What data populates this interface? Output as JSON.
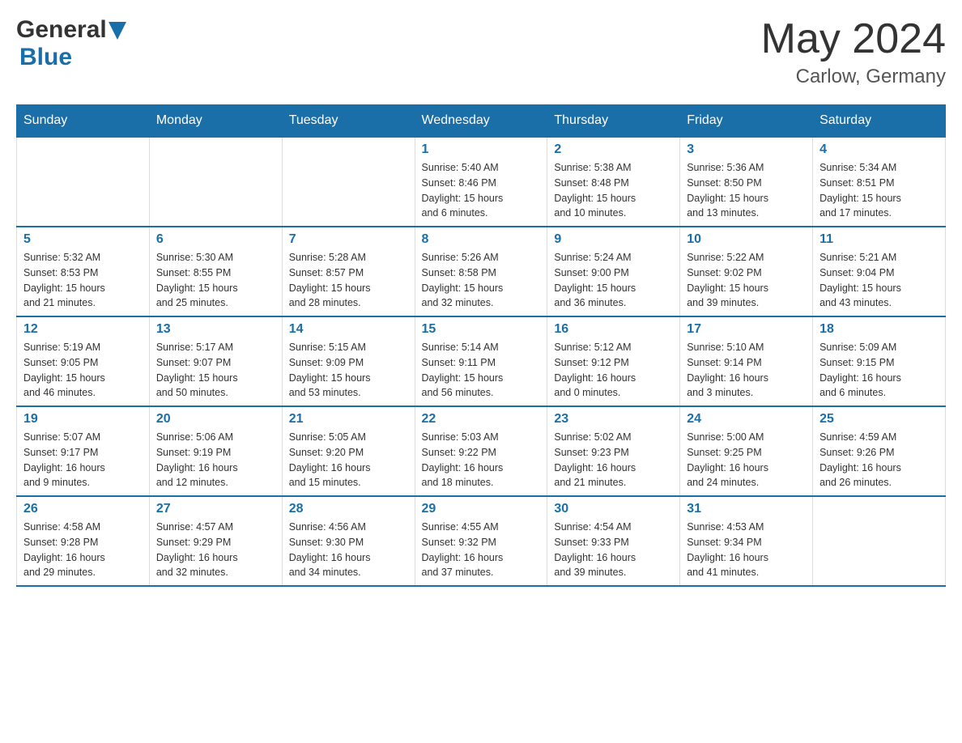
{
  "header": {
    "logo_general": "General",
    "logo_blue": "Blue",
    "month_year": "May 2024",
    "location": "Carlow, Germany"
  },
  "weekdays": [
    "Sunday",
    "Monday",
    "Tuesday",
    "Wednesday",
    "Thursday",
    "Friday",
    "Saturday"
  ],
  "weeks": [
    [
      {
        "day": "",
        "info": ""
      },
      {
        "day": "",
        "info": ""
      },
      {
        "day": "",
        "info": ""
      },
      {
        "day": "1",
        "info": "Sunrise: 5:40 AM\nSunset: 8:46 PM\nDaylight: 15 hours\nand 6 minutes."
      },
      {
        "day": "2",
        "info": "Sunrise: 5:38 AM\nSunset: 8:48 PM\nDaylight: 15 hours\nand 10 minutes."
      },
      {
        "day": "3",
        "info": "Sunrise: 5:36 AM\nSunset: 8:50 PM\nDaylight: 15 hours\nand 13 minutes."
      },
      {
        "day": "4",
        "info": "Sunrise: 5:34 AM\nSunset: 8:51 PM\nDaylight: 15 hours\nand 17 minutes."
      }
    ],
    [
      {
        "day": "5",
        "info": "Sunrise: 5:32 AM\nSunset: 8:53 PM\nDaylight: 15 hours\nand 21 minutes."
      },
      {
        "day": "6",
        "info": "Sunrise: 5:30 AM\nSunset: 8:55 PM\nDaylight: 15 hours\nand 25 minutes."
      },
      {
        "day": "7",
        "info": "Sunrise: 5:28 AM\nSunset: 8:57 PM\nDaylight: 15 hours\nand 28 minutes."
      },
      {
        "day": "8",
        "info": "Sunrise: 5:26 AM\nSunset: 8:58 PM\nDaylight: 15 hours\nand 32 minutes."
      },
      {
        "day": "9",
        "info": "Sunrise: 5:24 AM\nSunset: 9:00 PM\nDaylight: 15 hours\nand 36 minutes."
      },
      {
        "day": "10",
        "info": "Sunrise: 5:22 AM\nSunset: 9:02 PM\nDaylight: 15 hours\nand 39 minutes."
      },
      {
        "day": "11",
        "info": "Sunrise: 5:21 AM\nSunset: 9:04 PM\nDaylight: 15 hours\nand 43 minutes."
      }
    ],
    [
      {
        "day": "12",
        "info": "Sunrise: 5:19 AM\nSunset: 9:05 PM\nDaylight: 15 hours\nand 46 minutes."
      },
      {
        "day": "13",
        "info": "Sunrise: 5:17 AM\nSunset: 9:07 PM\nDaylight: 15 hours\nand 50 minutes."
      },
      {
        "day": "14",
        "info": "Sunrise: 5:15 AM\nSunset: 9:09 PM\nDaylight: 15 hours\nand 53 minutes."
      },
      {
        "day": "15",
        "info": "Sunrise: 5:14 AM\nSunset: 9:11 PM\nDaylight: 15 hours\nand 56 minutes."
      },
      {
        "day": "16",
        "info": "Sunrise: 5:12 AM\nSunset: 9:12 PM\nDaylight: 16 hours\nand 0 minutes."
      },
      {
        "day": "17",
        "info": "Sunrise: 5:10 AM\nSunset: 9:14 PM\nDaylight: 16 hours\nand 3 minutes."
      },
      {
        "day": "18",
        "info": "Sunrise: 5:09 AM\nSunset: 9:15 PM\nDaylight: 16 hours\nand 6 minutes."
      }
    ],
    [
      {
        "day": "19",
        "info": "Sunrise: 5:07 AM\nSunset: 9:17 PM\nDaylight: 16 hours\nand 9 minutes."
      },
      {
        "day": "20",
        "info": "Sunrise: 5:06 AM\nSunset: 9:19 PM\nDaylight: 16 hours\nand 12 minutes."
      },
      {
        "day": "21",
        "info": "Sunrise: 5:05 AM\nSunset: 9:20 PM\nDaylight: 16 hours\nand 15 minutes."
      },
      {
        "day": "22",
        "info": "Sunrise: 5:03 AM\nSunset: 9:22 PM\nDaylight: 16 hours\nand 18 minutes."
      },
      {
        "day": "23",
        "info": "Sunrise: 5:02 AM\nSunset: 9:23 PM\nDaylight: 16 hours\nand 21 minutes."
      },
      {
        "day": "24",
        "info": "Sunrise: 5:00 AM\nSunset: 9:25 PM\nDaylight: 16 hours\nand 24 minutes."
      },
      {
        "day": "25",
        "info": "Sunrise: 4:59 AM\nSunset: 9:26 PM\nDaylight: 16 hours\nand 26 minutes."
      }
    ],
    [
      {
        "day": "26",
        "info": "Sunrise: 4:58 AM\nSunset: 9:28 PM\nDaylight: 16 hours\nand 29 minutes."
      },
      {
        "day": "27",
        "info": "Sunrise: 4:57 AM\nSunset: 9:29 PM\nDaylight: 16 hours\nand 32 minutes."
      },
      {
        "day": "28",
        "info": "Sunrise: 4:56 AM\nSunset: 9:30 PM\nDaylight: 16 hours\nand 34 minutes."
      },
      {
        "day": "29",
        "info": "Sunrise: 4:55 AM\nSunset: 9:32 PM\nDaylight: 16 hours\nand 37 minutes."
      },
      {
        "day": "30",
        "info": "Sunrise: 4:54 AM\nSunset: 9:33 PM\nDaylight: 16 hours\nand 39 minutes."
      },
      {
        "day": "31",
        "info": "Sunrise: 4:53 AM\nSunset: 9:34 PM\nDaylight: 16 hours\nand 41 minutes."
      },
      {
        "day": "",
        "info": ""
      }
    ]
  ]
}
